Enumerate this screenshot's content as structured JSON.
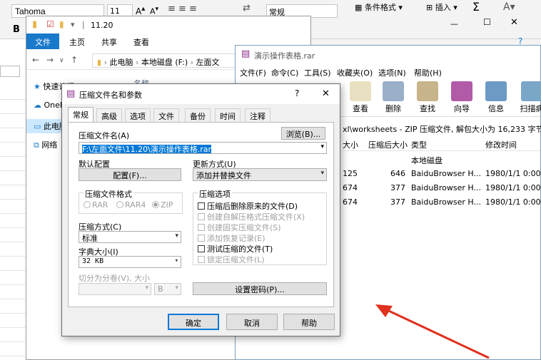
{
  "excel": {
    "font_name": "Tahoma",
    "font_size": "11",
    "number_format": "常规",
    "conditional_format": "条件格式",
    "insert": "插入",
    "bold": "B",
    "sigma": "Σ"
  },
  "explorer": {
    "title": "11.20",
    "tabs": [
      "文件",
      "主页",
      "共享",
      "查看"
    ],
    "path": [
      "此电脑",
      "本地磁盘 (F:)",
      "左面文"
    ],
    "side": [
      "快速访问",
      "OneDrive",
      "此电脑",
      "网络"
    ],
    "col_name": "名称"
  },
  "winrar": {
    "title": "演示操作表格.rar",
    "menu": [
      "文件(F)",
      "命令(C)",
      "工具(S)",
      "收藏夹(O)",
      "选项(N)",
      "帮助(H)"
    ],
    "tools": [
      "查看",
      "删除",
      "查找",
      "向导",
      "信息",
      "扫描病"
    ],
    "path": "xl\\worksheets - ZIP 压缩文件, 解包大小为 16,233 字节",
    "headers": [
      "大小",
      "压缩后大小",
      "类型",
      "修改时间"
    ],
    "rows": [
      {
        "size": "",
        "packed": "",
        "type": "本地磁盘",
        "modified": ""
      },
      {
        "size": "125",
        "packed": "646",
        "type": "BaiduBrowser H...",
        "modified": "1980/1/1 0:00"
      },
      {
        "size": "674",
        "packed": "377",
        "type": "BaiduBrowser H...",
        "modified": "1980/1/1 0:00"
      },
      {
        "size": "674",
        "packed": "377",
        "type": "BaiduBrowser H...",
        "modified": "1980/1/1 0:00"
      }
    ]
  },
  "dialog": {
    "title": "压缩文件名和参数",
    "help_glyph": "?",
    "close_glyph": "✕",
    "tabs": [
      "常规",
      "高级",
      "选项",
      "文件",
      "备份",
      "时间",
      "注释"
    ],
    "archive_label": "压缩文件名(A)",
    "browse": "浏览(B)...",
    "archive_value": "F:\\左面文件\\11.20\\演示操作表格.rar",
    "default_config": "默认配置",
    "profiles_btn": "配置(F)...",
    "update_label": "更新方式(U)",
    "update_value": "添加并替换文件",
    "format_group": "压缩文件格式",
    "formats": [
      "RAR",
      "RAR4",
      "ZIP"
    ],
    "options_group": "压缩选项",
    "options": [
      {
        "label": "压缩后删除原来的文件(D)",
        "enabled": true
      },
      {
        "label": "创建自解压格式压缩文件(X)",
        "enabled": false
      },
      {
        "label": "创建固实压缩文件(S)",
        "enabled": false
      },
      {
        "label": "添加恢复记录(E)",
        "enabled": false
      },
      {
        "label": "测试压缩的文件(T)",
        "enabled": true
      },
      {
        "label": "锁定压缩文件(L)",
        "enabled": false
      }
    ],
    "method_label": "压缩方式(C)",
    "method_value": "标准",
    "dict_label": "字典大小(I)",
    "dict_value": "32 KB",
    "split_label": "切分为分卷(V), 大小",
    "split_unit": "B",
    "password_btn": "设置密码(P)...",
    "ok": "确定",
    "cancel": "取消",
    "help": "帮助"
  },
  "colors": {
    "accent": "#1979ca",
    "focus": "#0078d7",
    "arrow": "#e0301e"
  }
}
